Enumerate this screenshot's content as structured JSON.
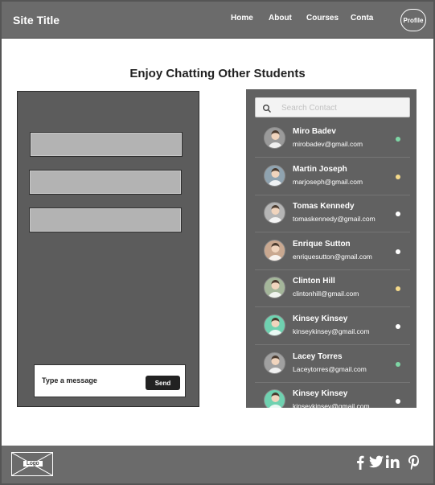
{
  "header": {
    "site_title": "Site Title",
    "nav": [
      "Home",
      "About",
      "Courses",
      "Conta"
    ],
    "profile_label": "Profile"
  },
  "main": {
    "heading": "Enjoy Chatting Other Students"
  },
  "chat": {
    "message_placeholder": "Type a message",
    "send_label": "Send"
  },
  "contacts": {
    "search_placeholder": "Search Contact",
    "items": [
      {
        "name": "Miro Badev",
        "email": "mirobadev@gmail.com",
        "status_color": "#7ed6a5",
        "avatar_color": "#9a9a9a"
      },
      {
        "name": "Martin Joseph",
        "email": "marjoseph@gmail.com",
        "status_color": "#f4d98a",
        "avatar_color": "#8fa3b0"
      },
      {
        "name": "Tomas Kennedy",
        "email": "tomaskennedy@gmail.com",
        "status_color": "#ffffff",
        "avatar_color": "#b5b5b5"
      },
      {
        "name": "Enrique Sutton",
        "email": "enriquesutton@gmail.com",
        "status_color": "#ffffff",
        "avatar_color": "#c9a890"
      },
      {
        "name": "Clinton Hill",
        "email": "clintonhill@gmail.com",
        "status_color": "#f4d98a",
        "avatar_color": "#a4b69a"
      },
      {
        "name": "Kinsey Kinsey",
        "email": "kinseykinsey@gmail.com",
        "status_color": "#ffffff",
        "avatar_color": "#6fd1b0"
      },
      {
        "name": "Lacey Torres",
        "email": "Laceytorres@gmail.com",
        "status_color": "#7ed6a5",
        "avatar_color": "#a0a0a0"
      },
      {
        "name": "Kinsey Kinsey",
        "email": "kinseykinsey@gmail.com",
        "status_color": "#ffffff",
        "avatar_color": "#6fd1b0"
      }
    ]
  },
  "footer": {
    "logo_label": "Logo",
    "social_icons": [
      "facebook-icon",
      "twitter-icon",
      "linkedin-icon",
      "pinterest-icon"
    ]
  }
}
